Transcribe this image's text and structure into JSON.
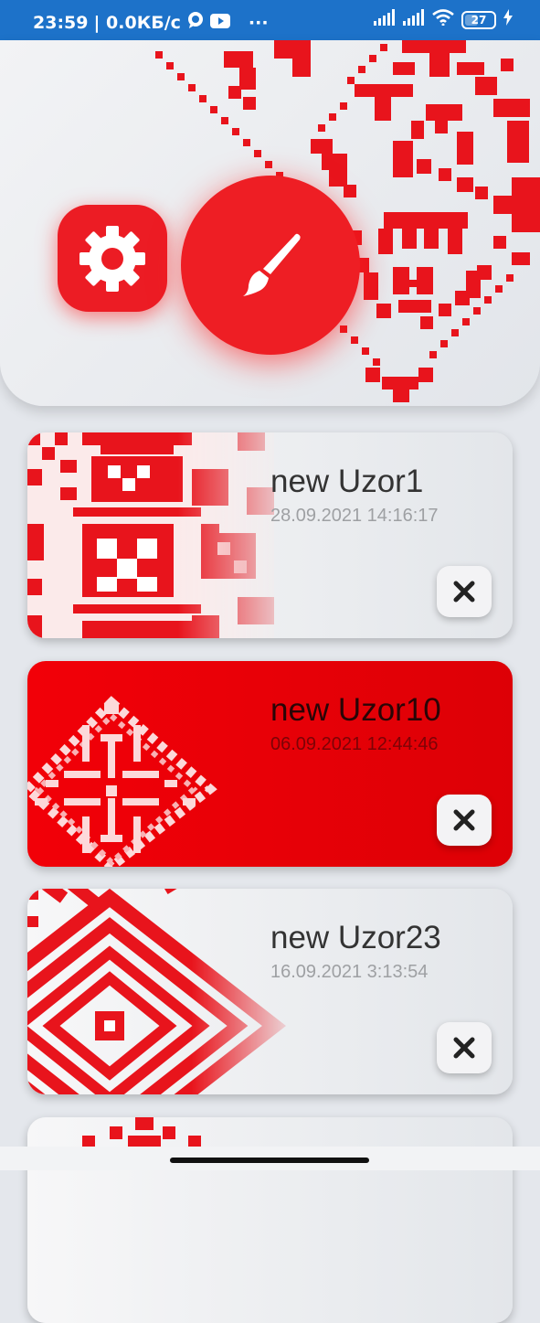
{
  "status_bar": {
    "time": "23:59",
    "network_speed": "| 0.0КБ/с",
    "more": "···",
    "battery": "27",
    "icons": [
      "chat-bubble-icon",
      "youtube-icon",
      "signal-icon",
      "signal-icon",
      "wifi-icon",
      "battery-icon",
      "charging-icon"
    ]
  },
  "header": {
    "settings_icon": "gear-icon",
    "paint_icon": "paintbrush-icon"
  },
  "patterns": [
    {
      "title": "new Uzor1",
      "date": "28.09.2021 14:16:17",
      "selected": false
    },
    {
      "title": "new Uzor10",
      "date": "06.09.2021 12:44:46",
      "selected": true
    },
    {
      "title": "new Uzor23",
      "date": "16.09.2021 3:13:54",
      "selected": false
    }
  ],
  "colors": {
    "accent": "#ee1e24",
    "status_bar": "#1d72c9",
    "background": "#e4e7ec"
  }
}
